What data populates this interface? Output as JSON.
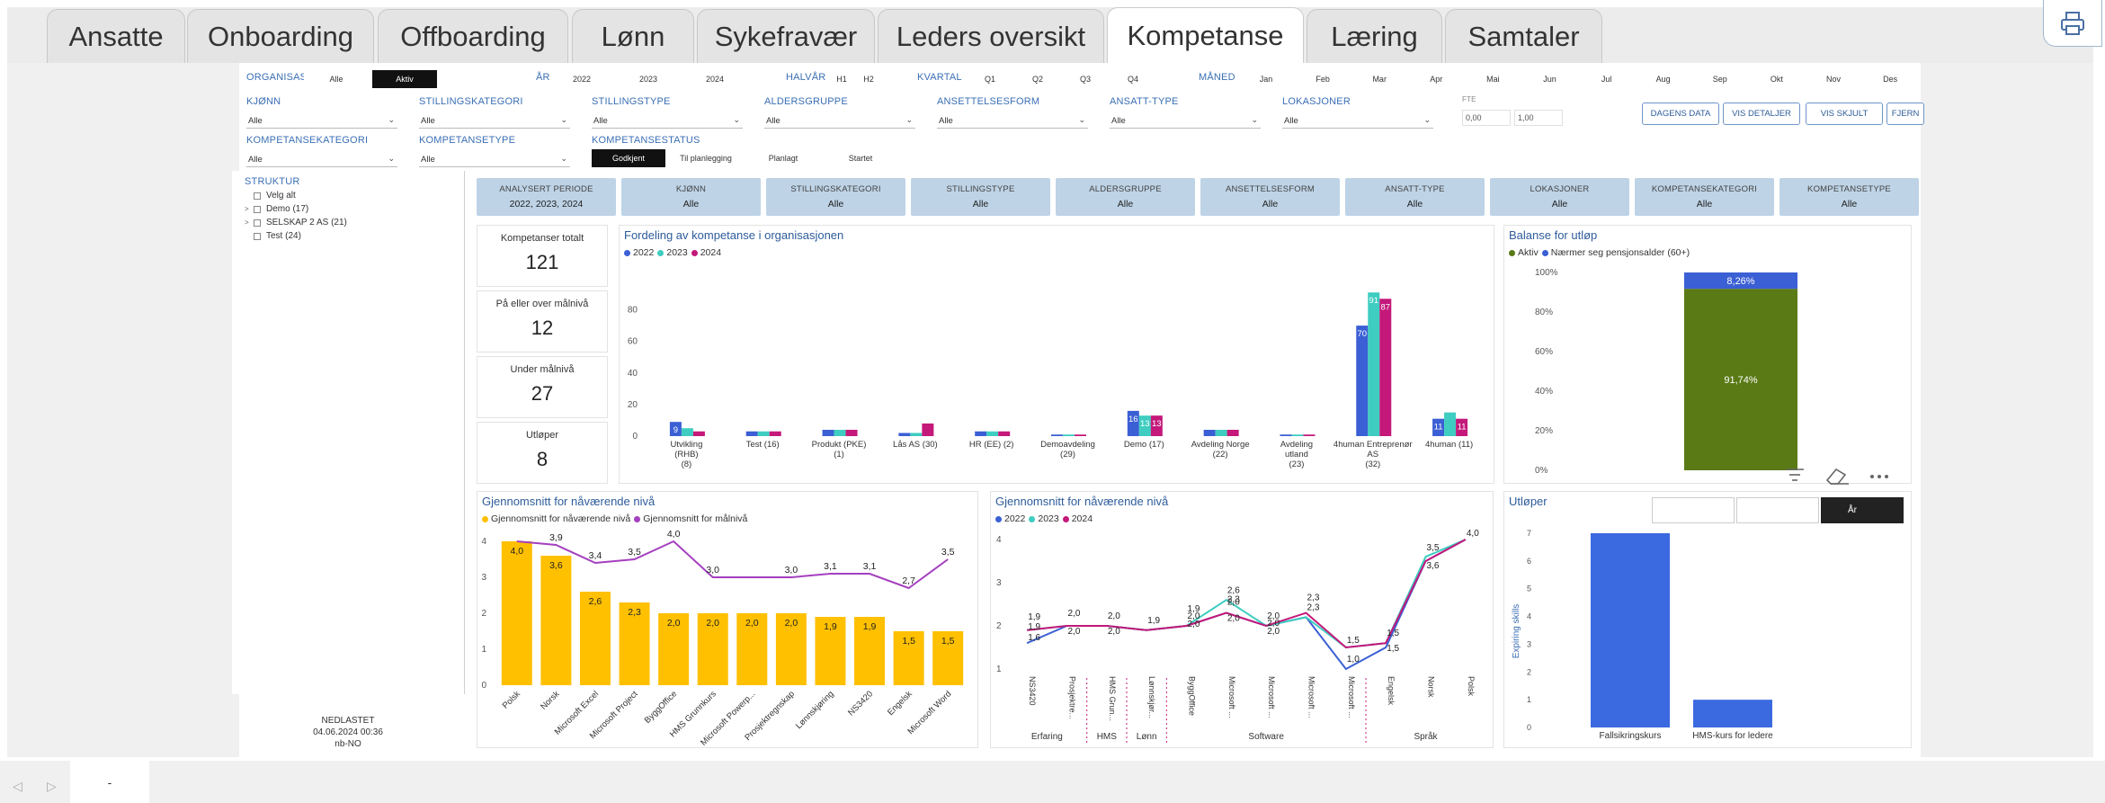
{
  "tabs": [
    {
      "label": "Ansatte",
      "active": false
    },
    {
      "label": "Onboarding",
      "active": false
    },
    {
      "label": "Offboarding",
      "active": false
    },
    {
      "label": "Lønn",
      "active": false
    },
    {
      "label": "Sykefravær",
      "active": false
    },
    {
      "label": "Leders oversikt",
      "active": false
    },
    {
      "label": "Kompetanse",
      "active": true
    },
    {
      "label": "Læring",
      "active": false
    },
    {
      "label": "Samtaler",
      "active": false
    }
  ],
  "toolbar": {
    "print_icon": "print-icon"
  },
  "filters": {
    "organisasjon": {
      "label": "ORGANISASJON",
      "options": [
        "Alle",
        "Aktiv"
      ],
      "selected": "Aktiv"
    },
    "ar": {
      "label": "ÅR",
      "options": [
        "2022",
        "2023",
        "2024"
      ]
    },
    "halvar": {
      "label": "HALVÅR",
      "options": [
        "H1",
        "H2"
      ]
    },
    "kvartal": {
      "label": "KVARTAL",
      "options": [
        "Q1",
        "Q2",
        "Q3",
        "Q4"
      ]
    },
    "maned": {
      "label": "MÅNED",
      "options": [
        "Jan",
        "Feb",
        "Mar",
        "Apr",
        "Mai",
        "Jun",
        "Jul",
        "Aug",
        "Sep",
        "Okt",
        "Nov",
        "Des"
      ]
    },
    "row2": [
      {
        "label": "KJØNN",
        "value": "Alle"
      },
      {
        "label": "STILLINGSKATEGORI",
        "value": "Alle"
      },
      {
        "label": "STILLINGSTYPE",
        "value": "Alle"
      },
      {
        "label": "ALDERSGRUPPE",
        "value": "Alle"
      },
      {
        "label": "ANSETTELSESFORM",
        "value": "Alle"
      },
      {
        "label": "ANSATT-TYPE",
        "value": "Alle"
      },
      {
        "label": "LOKASJONER",
        "value": "Alle"
      }
    ],
    "row3": [
      {
        "label": "KOMPETANSEKATEGORI",
        "value": "Alle"
      },
      {
        "label": "KOMPETANSETYPE",
        "value": "Alle"
      }
    ],
    "fte": {
      "label": "FTE",
      "min": "0,00",
      "max": "1,00"
    },
    "status": {
      "label": "KOMPETANSESTATUS",
      "options": [
        "Godkjent",
        "Til planlegging",
        "Planlagt",
        "Startet"
      ],
      "selected": "Godkjent"
    },
    "buttons": [
      "DAGENS DATA",
      "VIS DETALJER",
      "VIS SKJULT",
      "FJERN"
    ]
  },
  "struktur": {
    "label": "STRUKTUR",
    "items": [
      {
        "label": "Velg alt",
        "expander": ""
      },
      {
        "label": "Demo (17)",
        "expander": ">"
      },
      {
        "label": "SELSKAP 2 AS (21)",
        "expander": ">"
      },
      {
        "label": "Test (24)",
        "expander": ""
      }
    ]
  },
  "nedlastet": {
    "label": "NEDLASTET",
    "datetime": "04.06.2024 00:36",
    "locale": "nb-NO"
  },
  "cards": [
    {
      "title": "ANALYSERT PERIODE",
      "value": "2022, 2023, 2024"
    },
    {
      "title": "KJØNN",
      "value": "Alle"
    },
    {
      "title": "STILLINGSKATEGORI",
      "value": "Alle"
    },
    {
      "title": "STILLINGSTYPE",
      "value": "Alle"
    },
    {
      "title": "ALDERSGRUPPE",
      "value": "Alle"
    },
    {
      "title": "ANSETTELSESFORM",
      "value": "Alle"
    },
    {
      "title": "ANSATT-TYPE",
      "value": "Alle"
    },
    {
      "title": "LOKASJONER",
      "value": "Alle"
    },
    {
      "title": "KOMPETANSEKATEGORI",
      "value": "Alle"
    },
    {
      "title": "KOMPETANSETYPE",
      "value": "Alle"
    }
  ],
  "kpis": [
    {
      "label": "Kompetanser totalt",
      "value": "121"
    },
    {
      "label": "På eller over målnivå",
      "value": "12"
    },
    {
      "label": "Under målnivå",
      "value": "27"
    },
    {
      "label": "Utløper",
      "value": "8"
    }
  ],
  "chart_data": [
    {
      "id": "fordeling",
      "type": "bar",
      "title": "Fordeling av kompetanse i organisasjonen",
      "categories": [
        "Utvikling (RHB) (8)",
        "Test (16)",
        "Produkt (PKE) (1)",
        "Lås AS (30)",
        "HR (EE) (2)",
        "Demoavdeling (29)",
        "Demo (17)",
        "Avdeling Norge (22)",
        "Avdeling utland (23)",
        "4human Entreprenør AS (32)",
        "4human (11)"
      ],
      "series": [
        {
          "name": "2022",
          "color": "#3b5fd4",
          "values": [
            9,
            3,
            4,
            2,
            3,
            1,
            16,
            4,
            1,
            70,
            11
          ]
        },
        {
          "name": "2023",
          "color": "#3ecdc0",
          "values": [
            5,
            3,
            4,
            2,
            3,
            1,
            13,
            4,
            1,
            91,
            15
          ]
        },
        {
          "name": "2024",
          "color": "#c4187a",
          "values": [
            3,
            3,
            4,
            8,
            3,
            1,
            13,
            4,
            1,
            87,
            11
          ]
        }
      ],
      "data_labels": [
        [
          9,
          null,
          null,
          null,
          null,
          null,
          16,
          null,
          null,
          70,
          11
        ],
        [
          null,
          null,
          null,
          null,
          null,
          null,
          13,
          null,
          null,
          91,
          null
        ],
        [
          null,
          null,
          null,
          null,
          null,
          null,
          13,
          null,
          null,
          87,
          11
        ]
      ],
      "ylim": [
        0,
        100
      ],
      "yticks": [
        0,
        20,
        40,
        60,
        80
      ]
    },
    {
      "id": "balanse",
      "type": "bar",
      "title": "Balanse for utløp",
      "stacked": true,
      "series": [
        {
          "name": "Aktiv",
          "color": "#5a7a16",
          "values": [
            91.74
          ],
          "label": "91,74%"
        },
        {
          "name": "Nærmer seg pensjonsalder (60+)",
          "color": "#3b5fd4",
          "values": [
            8.26
          ],
          "label": "8,26%"
        }
      ],
      "yticks": [
        "0%",
        "20%",
        "40%",
        "60%",
        "80%",
        "100%"
      ],
      "ylim": [
        0,
        100
      ]
    },
    {
      "id": "snitt",
      "type": "bar",
      "title": "Gjennomsnitt for nåværende nivå",
      "categories": [
        "Polsk",
        "Norsk",
        "Microsoft Excel",
        "Microsoft Project",
        "ByggOffice",
        "HMS Grunnkurs",
        "Microsoft Powerp...",
        "Prosjektregnskap",
        "Lønnskjøring",
        "NS3420",
        "Engelsk",
        "Microsoft Word"
      ],
      "series": [
        {
          "name": "Gjennomsnitt for nåværende nivå",
          "color": "#ffc000",
          "values": [
            4.0,
            3.6,
            2.6,
            2.3,
            2.0,
            2.0,
            2.0,
            2.0,
            1.9,
            1.9,
            1.5,
            1.5
          ],
          "labels": [
            "4,0",
            "3,6",
            "2,6",
            "2,3",
            "2,0",
            "2,0",
            "2,0",
            "2,0",
            "1,9",
            "1,9",
            "1,5",
            "1,5"
          ]
        },
        {
          "name": "Gjennomsnitt for målnivå",
          "color": "#a43fbf",
          "values": [
            4.0,
            3.9,
            3.4,
            3.5,
            4.0,
            3.0,
            3.0,
            3.0,
            3.1,
            3.1,
            2.7,
            3.5
          ],
          "labels": [
            "",
            "3,9",
            "3,4",
            "3,5",
            "4,0",
            "3,0",
            "",
            "3,0",
            "3,1",
            "3,1",
            "2,7",
            "3,5"
          ]
        }
      ],
      "ylim": [
        0,
        4
      ],
      "yticks": [
        0,
        1,
        2,
        3,
        4
      ]
    },
    {
      "id": "snitt_ar",
      "type": "line",
      "title": "Gjennomsnitt for nåværende nivå",
      "categories": [
        "NS3420",
        "Prosjektre...",
        "HMS Grun...",
        "Lønnskjør...",
        "ByggOffice",
        "Microsoft ...",
        "Microsoft ...",
        "Microsoft ...",
        "Microsoft ...",
        "Engelsk",
        "Norsk",
        "Polsk"
      ],
      "groups": [
        {
          "name": "Erfaring",
          "span": [
            0,
            1
          ]
        },
        {
          "name": "HMS",
          "span": [
            2,
            2
          ]
        },
        {
          "name": "Lønn",
          "span": [
            3,
            3
          ]
        },
        {
          "name": "Software",
          "span": [
            4,
            8
          ]
        },
        {
          "name": "Språk",
          "span": [
            9,
            11
          ]
        }
      ],
      "series": [
        {
          "name": "2022",
          "color": "#3b5fd4",
          "values": [
            1.6,
            2.0,
            2.0,
            1.9,
            2.0,
            2.3,
            2.0,
            2.2,
            1.0,
            1.5,
            3.5,
            4.0
          ]
        },
        {
          "name": "2023",
          "color": "#3ecdc0",
          "values": [
            1.9,
            2.0,
            2.0,
            1.9,
            2.0,
            2.6,
            2.0,
            2.2,
            1.5,
            1.6,
            3.6,
            4.0
          ]
        },
        {
          "name": "2024",
          "color": "#c4187a",
          "values": [
            1.9,
            2.0,
            2.0,
            1.9,
            2.0,
            2.3,
            2.0,
            2.3,
            1.5,
            1.6,
            3.5,
            4.0
          ]
        }
      ],
      "annotations": [
        "1,9",
        "1,9",
        "1,6",
        "2,0",
        "2,0",
        "2,0",
        "2,0",
        "2,0",
        "2,0",
        "1,9",
        "1,9",
        "2,0",
        "2,0",
        "2,6",
        "2,3",
        "2,0",
        "2,0",
        "2,0",
        "2,3",
        "2,3",
        "1,5",
        "1,0",
        "1,5",
        "1,5",
        "3,5",
        "3,6",
        "4,0"
      ],
      "ylim": [
        1,
        4
      ],
      "yticks": [
        1,
        2,
        3,
        4
      ]
    },
    {
      "id": "utloper",
      "type": "bar",
      "title": "Utløper",
      "ylabel": "Expiring skills",
      "selector": "År",
      "categories": [
        "Fallsikringskurs",
        "HMS-kurs for ledere"
      ],
      "values": [
        7,
        1
      ],
      "color": "#3b69e0",
      "ylim": [
        0,
        7
      ],
      "yticks": [
        0,
        1,
        2,
        3,
        4,
        5,
        6,
        7
      ]
    }
  ],
  "visual_icons": [
    "filter-icon",
    "eraser-icon",
    "more-icon"
  ],
  "bottom": {
    "page_label": "-"
  }
}
